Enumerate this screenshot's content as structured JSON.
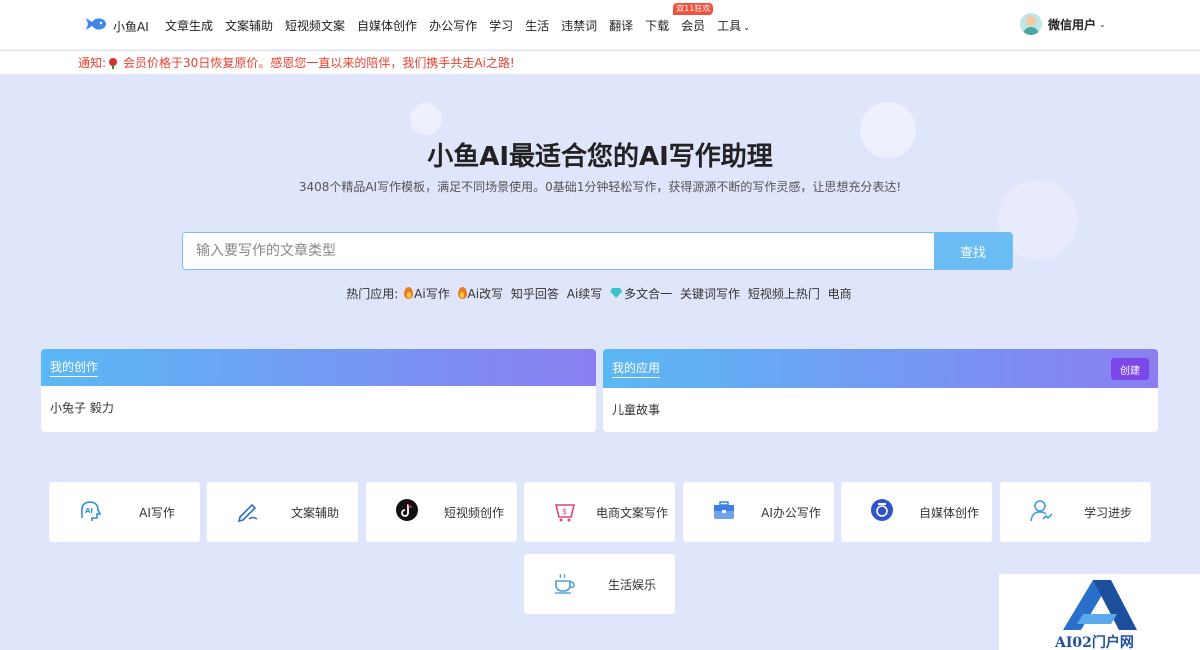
{
  "header": {
    "logo_text": "小鱼AI",
    "nav": [
      {
        "label": "文章生成"
      },
      {
        "label": "文案辅助"
      },
      {
        "label": "短视频文案"
      },
      {
        "label": "自媒体创作"
      },
      {
        "label": "办公写作"
      },
      {
        "label": "学习"
      },
      {
        "label": "生活"
      },
      {
        "label": "违禁词"
      },
      {
        "label": "翻译"
      },
      {
        "label": "下载"
      },
      {
        "label": "会员",
        "badge": "双11狂欢"
      },
      {
        "label": "工具"
      }
    ],
    "user_name": "微信用户"
  },
  "notice": {
    "prefix": "通知:",
    "text": "会员价格于30日恢复原价。感恩您一直以来的陪伴，我们携手共走Ai之路!"
  },
  "hero": {
    "title": "小鱼AI最适合您的AI写作助理",
    "subtitle": "3408个精品AI写作模板，满足不同场景使用。0基础1分钟轻松写作，获得源源不断的写作灵感，让思想充分表达!",
    "search_placeholder": "输入要写作的文章类型",
    "search_button": "查找",
    "hot_label": "热门应用:",
    "hot_items": [
      "Ai写作",
      "Ai改写",
      "知乎回答",
      "Ai续写",
      "多文合一",
      "关键词写作",
      "短视频上热门",
      "电商"
    ]
  },
  "cards": {
    "my_creation": {
      "title": "我的创作",
      "item": "小兔子 毅力"
    },
    "my_apps": {
      "title": "我的应用",
      "create_button": "创建",
      "item": "儿童故事"
    }
  },
  "categories": [
    {
      "label": "AI写作",
      "icon": "ai-head-icon",
      "color": "#2e8fd8"
    },
    {
      "label": "文案辅助",
      "icon": "pen-icon",
      "color": "#2e6fc8"
    },
    {
      "label": "短视频创作",
      "icon": "tiktok-icon",
      "color": "#111111"
    },
    {
      "label": "电商文案写作",
      "icon": "shopping-bag-icon",
      "color": "#e0457a"
    },
    {
      "label": "AI办公写作",
      "icon": "briefcase-icon",
      "color": "#3d7fe0"
    },
    {
      "label": "自媒体创作",
      "icon": "media-badge-icon",
      "color": "#2f55c8"
    },
    {
      "label": "学习进步",
      "icon": "student-icon",
      "color": "#3aa0d8"
    },
    {
      "label": "生活娱乐",
      "icon": "coffee-cup-icon",
      "color": "#4aa0e0"
    }
  ],
  "watermark": {
    "text": "AI02门户网"
  }
}
